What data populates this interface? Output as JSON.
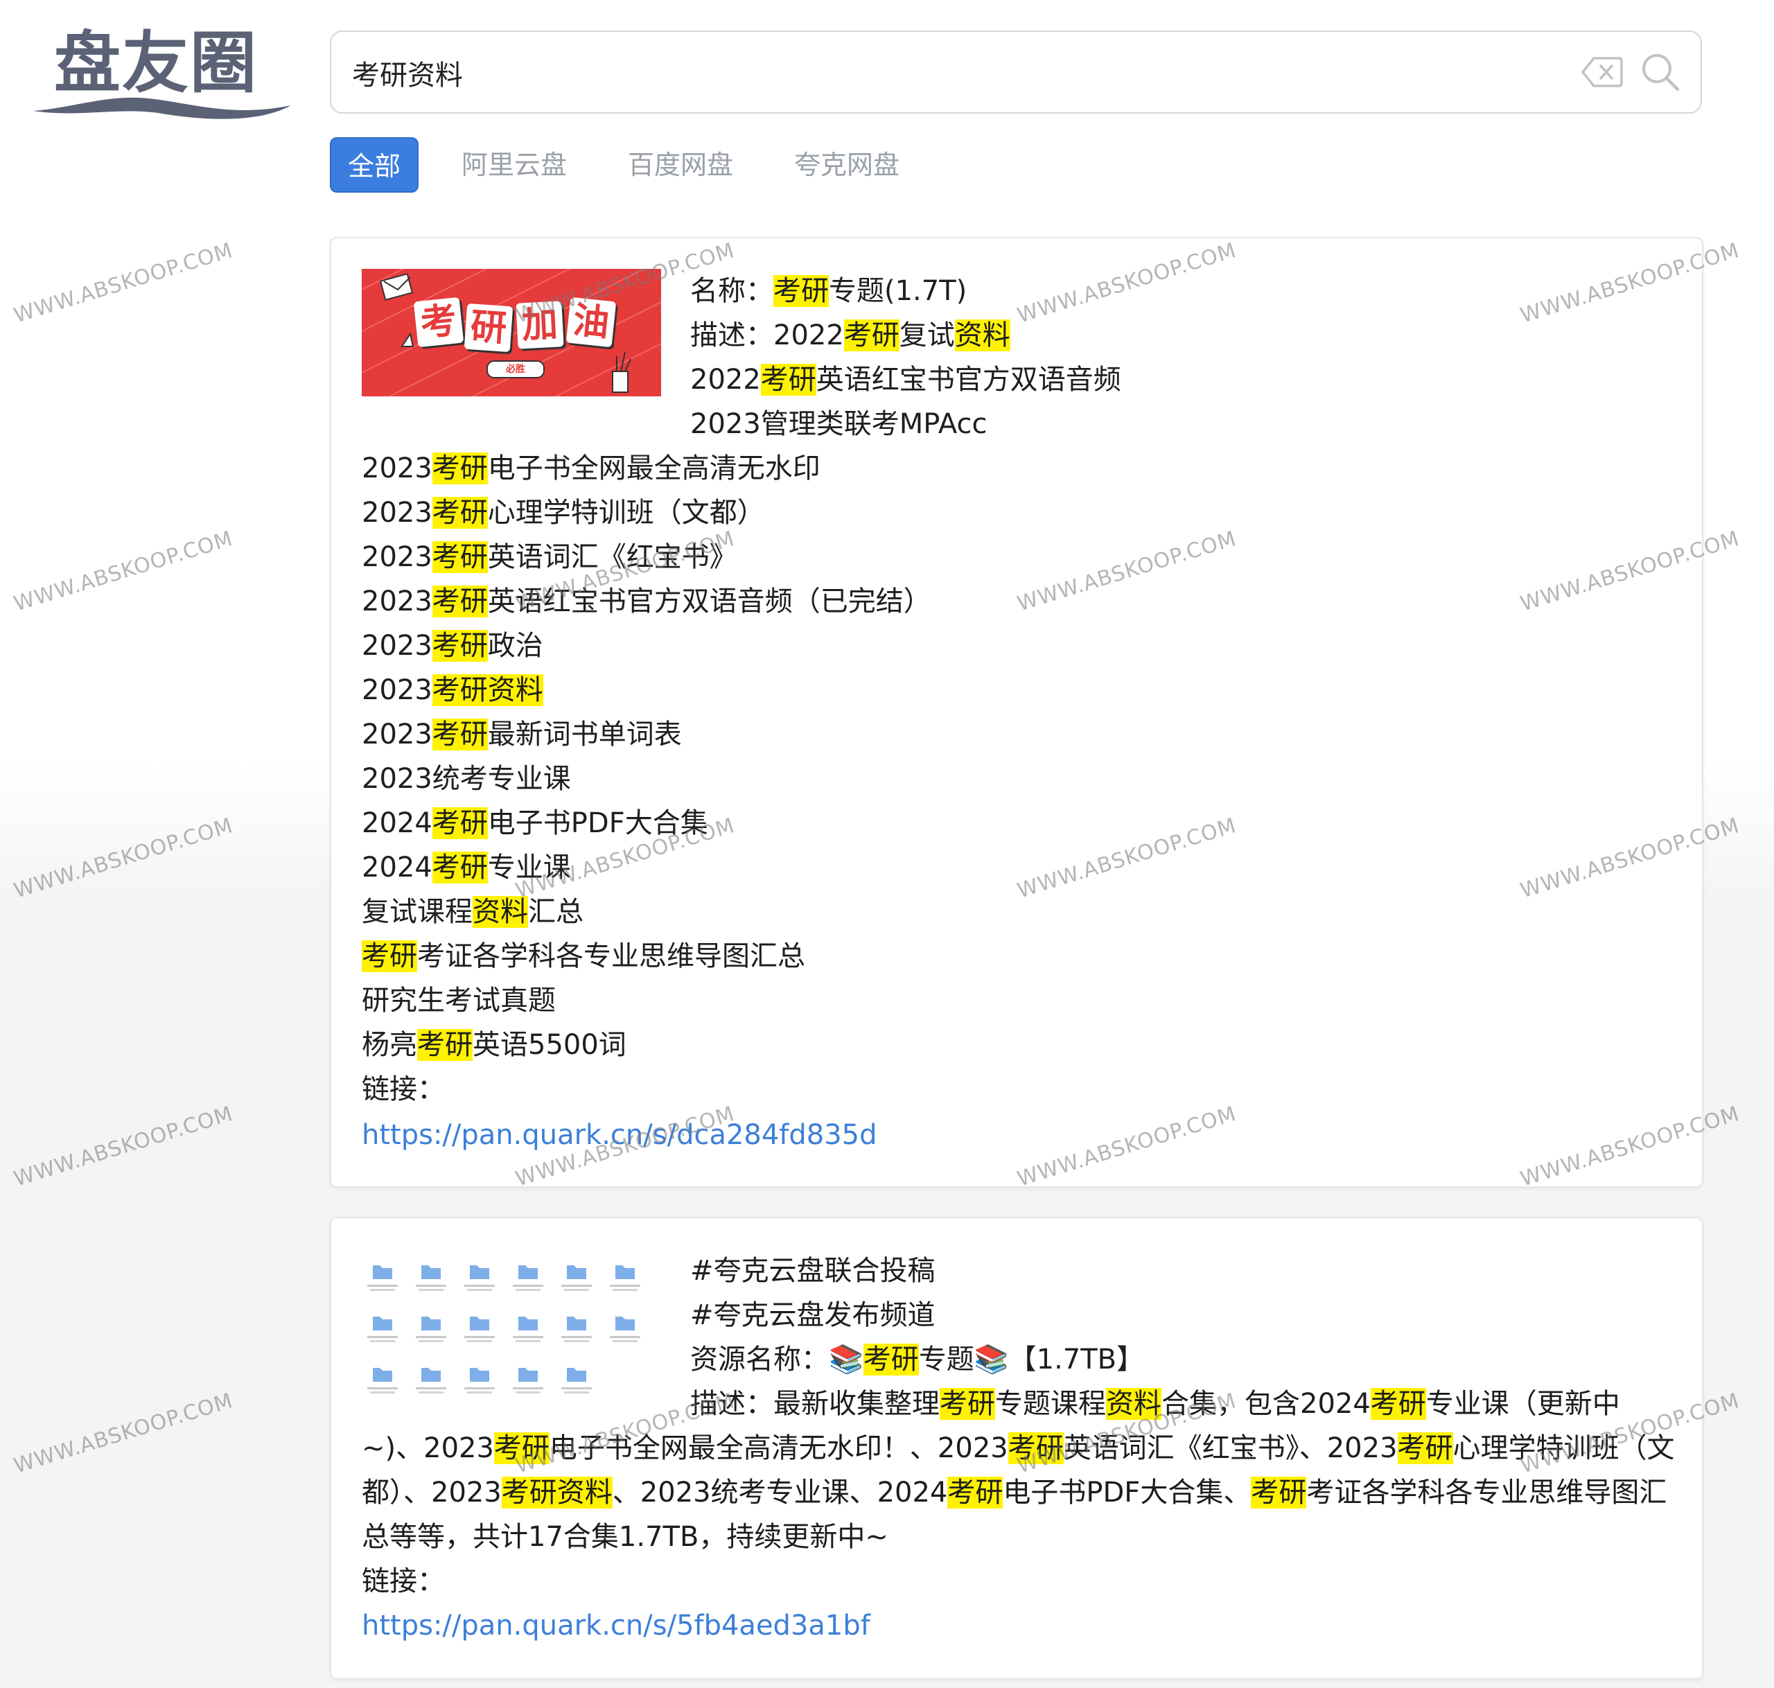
{
  "logo": {
    "text": "盘友圈"
  },
  "search": {
    "value": "考研资料"
  },
  "tabs": [
    {
      "label": "全部",
      "active": true
    },
    {
      "label": "阿里云盘",
      "active": false
    },
    {
      "label": "百度网盘",
      "active": false
    },
    {
      "label": "夸克网盘",
      "active": false
    }
  ],
  "results": [
    {
      "thumbnail_text": [
        "考",
        "研",
        "加",
        "油"
      ],
      "thumbnail_badge": "必胜",
      "lines": [
        [
          {
            "t": "名称："
          },
          {
            "t": "考研",
            "hl": true
          },
          {
            "t": "专题(1.7T)"
          }
        ],
        [
          {
            "t": "描述：2022"
          },
          {
            "t": "考研",
            "hl": true
          },
          {
            "t": "复试"
          },
          {
            "t": "资料",
            "hl": true
          }
        ],
        [
          {
            "t": "2022"
          },
          {
            "t": "考研",
            "hl": true
          },
          {
            "t": "英语红宝书官方双语音频"
          }
        ],
        [
          {
            "t": "2023管理类联考MPAcc"
          }
        ],
        [
          {
            "t": "2023"
          },
          {
            "t": "考研",
            "hl": true
          },
          {
            "t": "电子书全网最全高清无水印"
          }
        ],
        [
          {
            "t": "2023"
          },
          {
            "t": "考研",
            "hl": true
          },
          {
            "t": "心理学特训班（文都）"
          }
        ],
        [
          {
            "t": "2023"
          },
          {
            "t": "考研",
            "hl": true
          },
          {
            "t": "英语词汇《红宝书》"
          }
        ],
        [
          {
            "t": "2023"
          },
          {
            "t": "考研",
            "hl": true
          },
          {
            "t": "英语红宝书官方双语音频（已完结）"
          }
        ],
        [
          {
            "t": "2023"
          },
          {
            "t": "考研",
            "hl": true
          },
          {
            "t": "政治"
          }
        ],
        [
          {
            "t": "2023"
          },
          {
            "t": "考研资料",
            "hl": true
          }
        ],
        [
          {
            "t": "2023"
          },
          {
            "t": "考研",
            "hl": true
          },
          {
            "t": "最新词书单词表"
          }
        ],
        [
          {
            "t": "2023统考专业课"
          }
        ],
        [
          {
            "t": "2024"
          },
          {
            "t": "考研",
            "hl": true
          },
          {
            "t": "电子书PDF大合集"
          }
        ],
        [
          {
            "t": "2024"
          },
          {
            "t": "考研",
            "hl": true
          },
          {
            "t": "专业课"
          }
        ],
        [
          {
            "t": "复试课程"
          },
          {
            "t": "资料",
            "hl": true
          },
          {
            "t": "汇总"
          }
        ],
        [
          {
            "t": "考研",
            "hl": true
          },
          {
            "t": "考证各学科各专业思维导图汇总"
          }
        ],
        [
          {
            "t": "研究生考试真题"
          }
        ],
        [
          {
            "t": "杨亮"
          },
          {
            "t": "考研",
            "hl": true
          },
          {
            "t": "英语5500词"
          }
        ],
        [
          {
            "t": "链接："
          }
        ]
      ],
      "link": "https://pan.quark.cn/s/dca284fd835d"
    },
    {
      "lines": [
        [
          {
            "t": "#夸克云盘联合投稿"
          }
        ],
        [
          {
            "t": "#夸克云盘发布频道"
          }
        ],
        [
          {
            "t": "资源名称：📚"
          },
          {
            "t": "考研",
            "hl": true
          },
          {
            "t": "专题📚【1.7TB】"
          }
        ]
      ],
      "desc": [
        {
          "t": "描述：最新收集整理"
        },
        {
          "t": "考研",
          "hl": true
        },
        {
          "t": "专题课程"
        },
        {
          "t": "资料",
          "hl": true
        },
        {
          "t": "合集，包含2024"
        },
        {
          "t": "考研",
          "hl": true
        },
        {
          "t": "专业课（更新中~)、2023"
        },
        {
          "t": "考研",
          "hl": true
        },
        {
          "t": "电子书全网最全高清无水印！、2023"
        },
        {
          "t": "考研",
          "hl": true
        },
        {
          "t": "英语词汇《红宝书》、2023"
        },
        {
          "t": "考研",
          "hl": true
        },
        {
          "t": "心理学特训班（文都）、2023"
        },
        {
          "t": "考研资料",
          "hl": true
        },
        {
          "t": "、2023统考专业课、2024"
        },
        {
          "t": "考研",
          "hl": true
        },
        {
          "t": "电子书PDF大合集、"
        },
        {
          "t": "考研",
          "hl": true
        },
        {
          "t": "考证各学科各专业思维导图汇总等等，共计17合集1.7TB，持续更新中~"
        }
      ],
      "link_label": "链接：",
      "link": "https://pan.quark.cn/s/5fb4aed3a1bf"
    }
  ],
  "watermark": "WWW.ABSKOOP.COM",
  "colors": {
    "accent": "#3b7ee0",
    "highlight": "#fff200",
    "link": "#3c7fd9"
  }
}
